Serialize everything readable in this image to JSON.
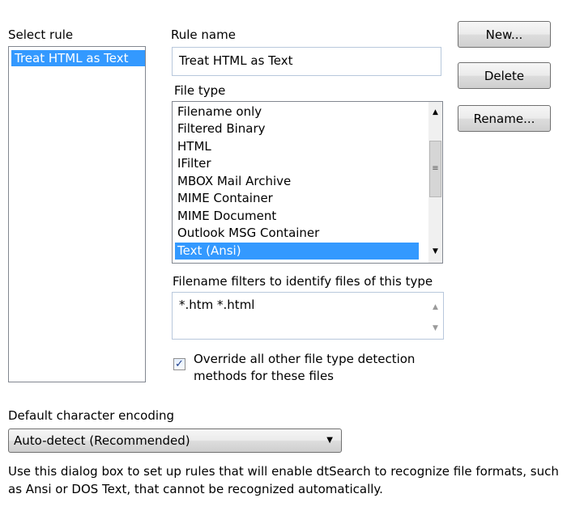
{
  "select_rule": {
    "label": "Select rule",
    "items": [
      {
        "label": "Treat HTML as Text",
        "selected": true
      }
    ]
  },
  "rule_name": {
    "label": "Rule name",
    "value": "Treat HTML as Text"
  },
  "file_type": {
    "label": "File type",
    "items": [
      {
        "label": "Filename only",
        "selected": false
      },
      {
        "label": "Filtered Binary",
        "selected": false
      },
      {
        "label": "HTML",
        "selected": false
      },
      {
        "label": "IFilter",
        "selected": false
      },
      {
        "label": "MBOX Mail Archive",
        "selected": false
      },
      {
        "label": "MIME Container",
        "selected": false
      },
      {
        "label": "MIME Document",
        "selected": false
      },
      {
        "label": "Outlook MSG Container",
        "selected": false
      },
      {
        "label": "Text (Ansi)",
        "selected": true
      }
    ]
  },
  "filters": {
    "label": "Filename filters to identify files of this type",
    "value": "*.htm *.html"
  },
  "override": {
    "label_line1": "Override all other file type detection",
    "label_line2": "methods for these files",
    "checked": true,
    "check_glyph": "✓"
  },
  "buttons": {
    "new_label": "New...",
    "delete_label": "Delete",
    "rename_label": "Rename..."
  },
  "encoding": {
    "label": "Default character encoding",
    "value": "Auto-detect (Recommended)"
  },
  "help_text": "Use this dialog box to set up rules that will enable dtSearch to recognize file formats, such as Ansi or DOS Text, that cannot be recognized automatically.",
  "icons": {
    "scroll_up": "▲",
    "scroll_down": "▼",
    "grip": "≡",
    "dropdown": "▼"
  },
  "colors": {
    "selection": "#3399ff",
    "selection_text": "#ffffff",
    "input_border": "#b8c8dc"
  }
}
